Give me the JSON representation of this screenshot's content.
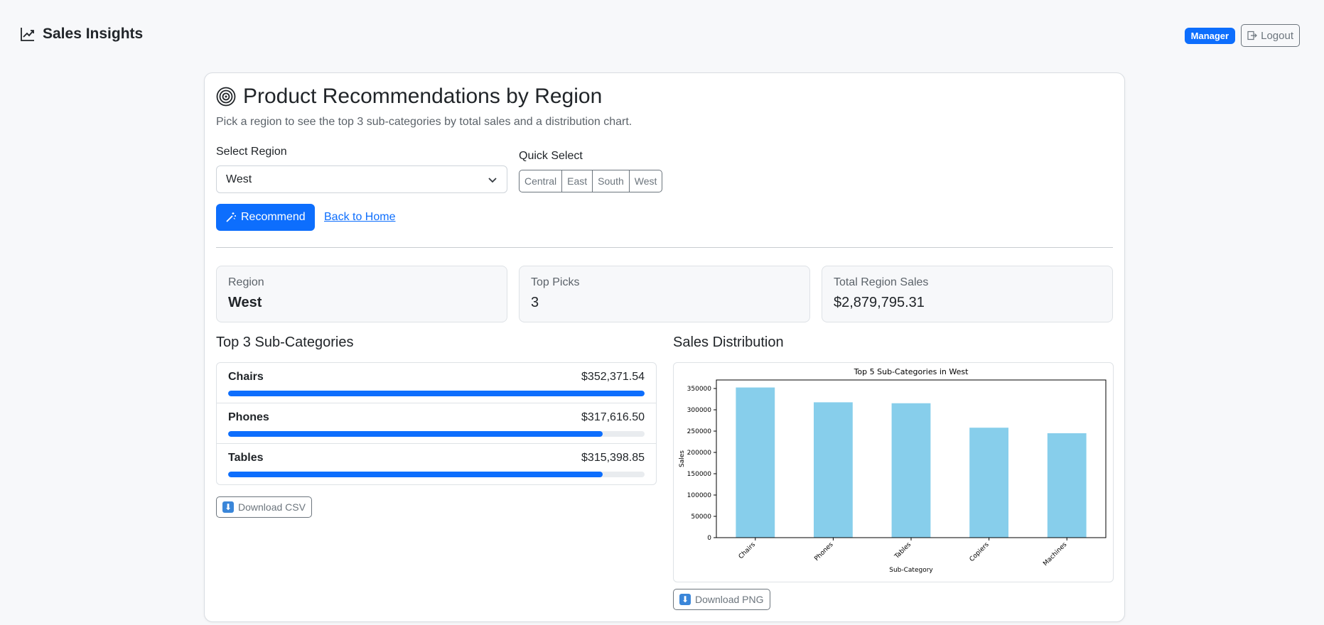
{
  "navbar": {
    "brand": "Sales Insights",
    "role_badge": "Manager",
    "logout_label": "Logout"
  },
  "page": {
    "title": "Product Recommendations by Region",
    "subtitle": "Pick a region to see the top 3 sub-categories by total sales and a distribution chart."
  },
  "form": {
    "select_label": "Select Region",
    "selected_region": "West",
    "quick_select_label": "Quick Select",
    "quick_select": [
      "Central",
      "East",
      "South",
      "West"
    ],
    "recommend_label": "Recommend",
    "home_link": "Back to Home"
  },
  "stats": [
    {
      "label": "Region",
      "value": "West"
    },
    {
      "label": "Top Picks",
      "value": "3"
    },
    {
      "label": "Total Region Sales",
      "value": "$2,879,795.31"
    }
  ],
  "top": {
    "heading": "Top 3 Sub-Categories",
    "items": [
      {
        "name": "Chairs",
        "amount": "$352,371.54",
        "progress": 1.0
      },
      {
        "name": "Phones",
        "amount": "$317,616.50",
        "progress": 0.9
      },
      {
        "name": "Tables",
        "amount": "$315,398.85",
        "progress": 0.9
      }
    ],
    "download_label": "Download CSV"
  },
  "distribution": {
    "heading": "Sales Distribution",
    "download_label": "Download PNG"
  },
  "chart_data": {
    "type": "bar",
    "title": "Top 5 Sub-Categories in West",
    "xlabel": "Sub-Category",
    "ylabel": "Sales",
    "categories": [
      "Chairs",
      "Phones",
      "Tables",
      "Copiers",
      "Machines"
    ],
    "values": [
      352371.54,
      317616.5,
      315398.85,
      258000,
      245000
    ],
    "yticks": [
      "0",
      "50000",
      "100000",
      "150000",
      "200000",
      "250000",
      "300000",
      "350000"
    ],
    "ylim": [
      0,
      370000
    ],
    "bar_color": "#87ceeb"
  },
  "colors": {
    "primary": "#0d6efd",
    "secondary": "#6c757d",
    "bar": "#87ceeb"
  }
}
